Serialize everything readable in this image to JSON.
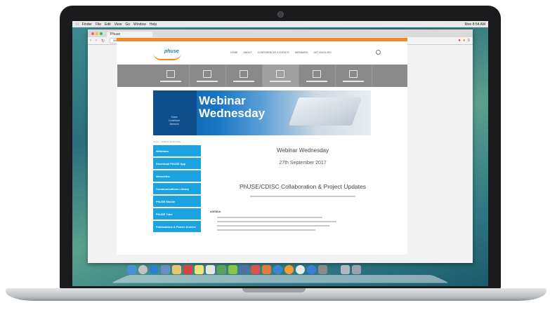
{
  "menubar": {
    "items": [
      "Finder",
      "File",
      "Edit",
      "View",
      "Go",
      "Window",
      "Help"
    ],
    "right": "Mon 8:54 AM"
  },
  "browser": {
    "tab_label": "Phuse",
    "url": "www.phuse.eu/webinars"
  },
  "site": {
    "logo_text": "phuse",
    "nav": [
      "HOME",
      "ABOUT",
      "CONFERENCES & EVENTS",
      "WEBINARS",
      "GET INVOLVED"
    ],
    "banner": {
      "line1": "Webinar",
      "line2": "Wednesday",
      "side_text": [
        "Share",
        "Contribute",
        "Network"
      ]
    },
    "breadcrumb": "Home > Webinar Wednesday",
    "sidebar": [
      "Webinars",
      "Download PhUSE App",
      "Newsletter",
      "Communications Library",
      "PhUSE Mobile",
      "PhUSE Tube",
      "Publications & Poster Archive"
    ],
    "content": {
      "title": "Webinar Wednesday",
      "date": "27th September 2017",
      "subtitle": "PhUSE/CDISC Collaboration & Project Updates",
      "agenda_label": "AGENDA"
    }
  },
  "colors": {
    "accent_orange": "#f08a24",
    "sidebar_blue": "#1aa3e0",
    "banner_blue": "#0e5a9e"
  }
}
